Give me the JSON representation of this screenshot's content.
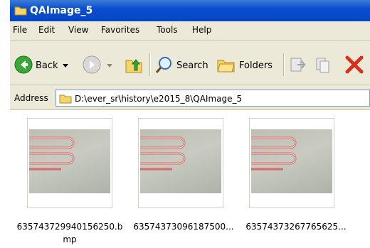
{
  "window": {
    "title": "QAImage_5"
  },
  "menu": {
    "items": [
      {
        "label": "File"
      },
      {
        "label": "Edit"
      },
      {
        "label": "View"
      },
      {
        "label": "Favorites"
      },
      {
        "label": "Tools"
      },
      {
        "label": "Help"
      }
    ]
  },
  "toolbar": {
    "back_label": "Back",
    "search_label": "Search",
    "folders_label": "Folders"
  },
  "address": {
    "label": "Address",
    "path": "D:\\ever_sr\\history\\e2015_8\\QAImage_5"
  },
  "files": [
    {
      "name_line1": "635743729940156250.b",
      "name_line2": "mp"
    },
    {
      "name_line1": "63574373096187500...",
      "name_line2": ""
    },
    {
      "name_line1": "63574373267765625...",
      "name_line2": ""
    }
  ],
  "colors": {
    "titlebar": "#0a4fd0",
    "chrome": "#ece9d8",
    "trace": "#d96a6a"
  }
}
